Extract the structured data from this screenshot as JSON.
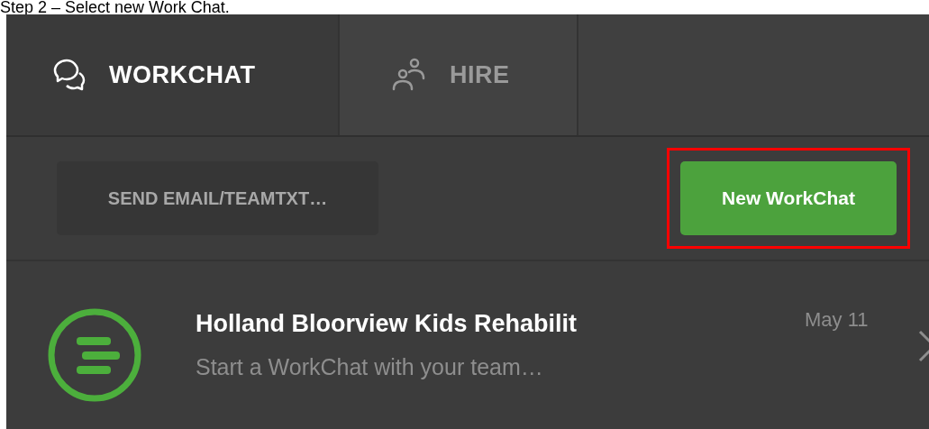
{
  "caption": "Step 2 – Select new Work Chat.",
  "tabs": [
    {
      "label": "WORKCHAT",
      "kind": "chat",
      "selected": true
    },
    {
      "label": "HIRE",
      "kind": "people",
      "selected": false
    }
  ],
  "toolbar": {
    "send_button": "SEND EMAIL/TEAMTXT…",
    "new_button": "New WorkChat",
    "highlighted": true
  },
  "conversations": [
    {
      "title": "Holland Bloorview Kids Rehabilit",
      "preview": "Start a WorkChat with your team…",
      "date": "May 11"
    }
  ]
}
